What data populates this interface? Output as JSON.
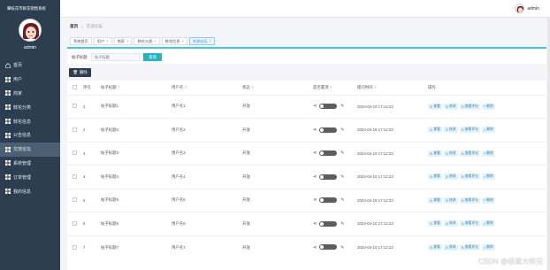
{
  "app": {
    "title": "攀枝花市鲜花销售系统"
  },
  "sidebar": {
    "username": "admin",
    "items": [
      {
        "label": "首页",
        "icon": "home-icon",
        "active": false
      },
      {
        "label": "用户",
        "icon": "grid-icon",
        "active": false
      },
      {
        "label": "商家",
        "icon": "grid-icon",
        "active": false
      },
      {
        "label": "鲜花分类",
        "icon": "grid-icon",
        "active": false
      },
      {
        "label": "鲜花信息",
        "icon": "grid-icon",
        "active": false
      },
      {
        "label": "公告信息",
        "icon": "grid-icon",
        "active": false
      },
      {
        "label": "交流论坛",
        "icon": "grid-icon",
        "active": true
      },
      {
        "label": "系统管理",
        "icon": "grid-icon",
        "active": false
      },
      {
        "label": "订单管理",
        "icon": "grid-icon",
        "active": false
      },
      {
        "label": "我的信息",
        "icon": "grid-icon",
        "active": false
      }
    ]
  },
  "header": {
    "username": "admin"
  },
  "breadcrumb": {
    "home": "首页",
    "current": "交流论坛"
  },
  "tabs": [
    {
      "label": "系统首页",
      "closable": false,
      "active": false
    },
    {
      "label": "用户",
      "closable": true,
      "active": false
    },
    {
      "label": "商家",
      "closable": true,
      "active": false
    },
    {
      "label": "鲜花分类",
      "closable": true,
      "active": false
    },
    {
      "label": "鲜花信息",
      "closable": true,
      "active": false
    },
    {
      "label": "交流论坛",
      "closable": true,
      "active": true
    }
  ],
  "search": {
    "label": "帖子标题",
    "placeholder": "帖子标题",
    "button": "查询"
  },
  "toolbar": {
    "delete_label": "删除"
  },
  "table": {
    "headers": [
      "",
      "序号",
      "帖子标题",
      "用户名",
      "状态",
      "是否置顶",
      "提问时间",
      "操作"
    ],
    "ops": {
      "view": "查看",
      "edit": "修改",
      "comments": "查看评论",
      "delete": "删除"
    },
    "rows": [
      {
        "index": "1",
        "title": "帖子标题1",
        "user": "用户名1",
        "status": "开放",
        "time": "2024-04-10 17:12:22"
      },
      {
        "index": "2",
        "title": "帖子标题2",
        "user": "用户名2",
        "status": "开放",
        "time": "2024-04-10 17:12:22"
      },
      {
        "index": "3",
        "title": "帖子标题3",
        "user": "用户名3",
        "status": "开放",
        "time": "2024-04-10 17:12:22"
      },
      {
        "index": "4",
        "title": "帖子标题4",
        "user": "用户名4",
        "status": "开放",
        "time": "2024-04-10 17:12:22"
      },
      {
        "index": "5",
        "title": "帖子标题5",
        "user": "用户名5",
        "status": "开放",
        "time": "2024-04-10 17:12:22"
      },
      {
        "index": "6",
        "title": "帖子标题6",
        "user": "用户名6",
        "status": "开放",
        "time": "2024-04-10 17:12:22"
      },
      {
        "index": "7",
        "title": "帖子标题7",
        "user": "用户名7",
        "status": "开放",
        "time": "2024-04-10 17:12:22"
      }
    ]
  },
  "watermark": "CSDN @倍速大师兄",
  "colors": {
    "sidebar": "#2d3e50",
    "accent": "#26b5bf",
    "active_tab": "#2f8fd8"
  }
}
